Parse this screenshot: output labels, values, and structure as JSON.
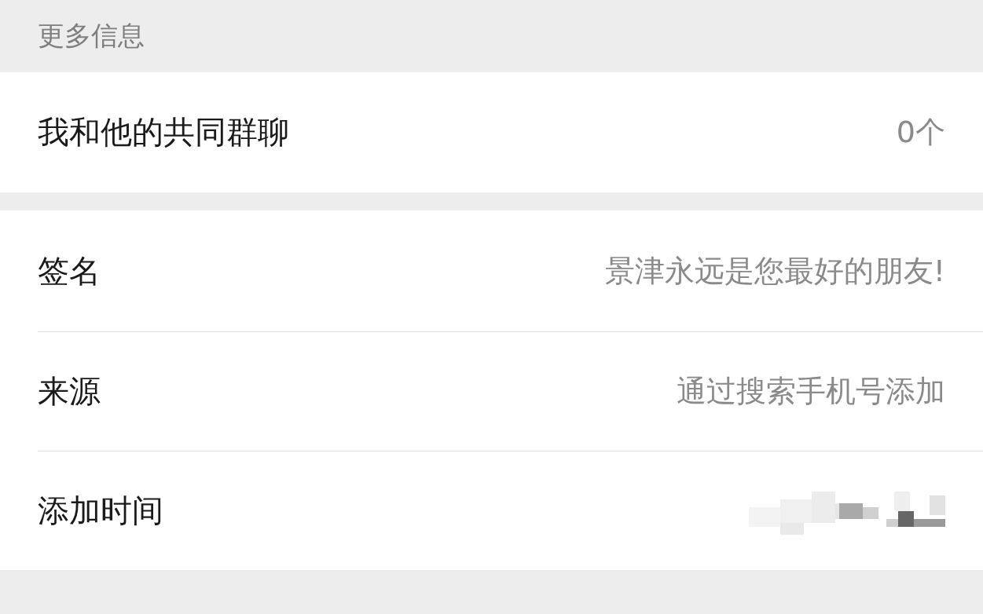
{
  "section_header": "更多信息",
  "common_groups": {
    "label": "我和他的共同群聊",
    "value": "0个"
  },
  "details": [
    {
      "kind": "text",
      "label": "签名",
      "value": "景津永远是您最好的朋友!"
    },
    {
      "kind": "text",
      "label": "来源",
      "value": "通过搜索手机号添加"
    },
    {
      "kind": "obscured",
      "label": "添加时间"
    }
  ]
}
